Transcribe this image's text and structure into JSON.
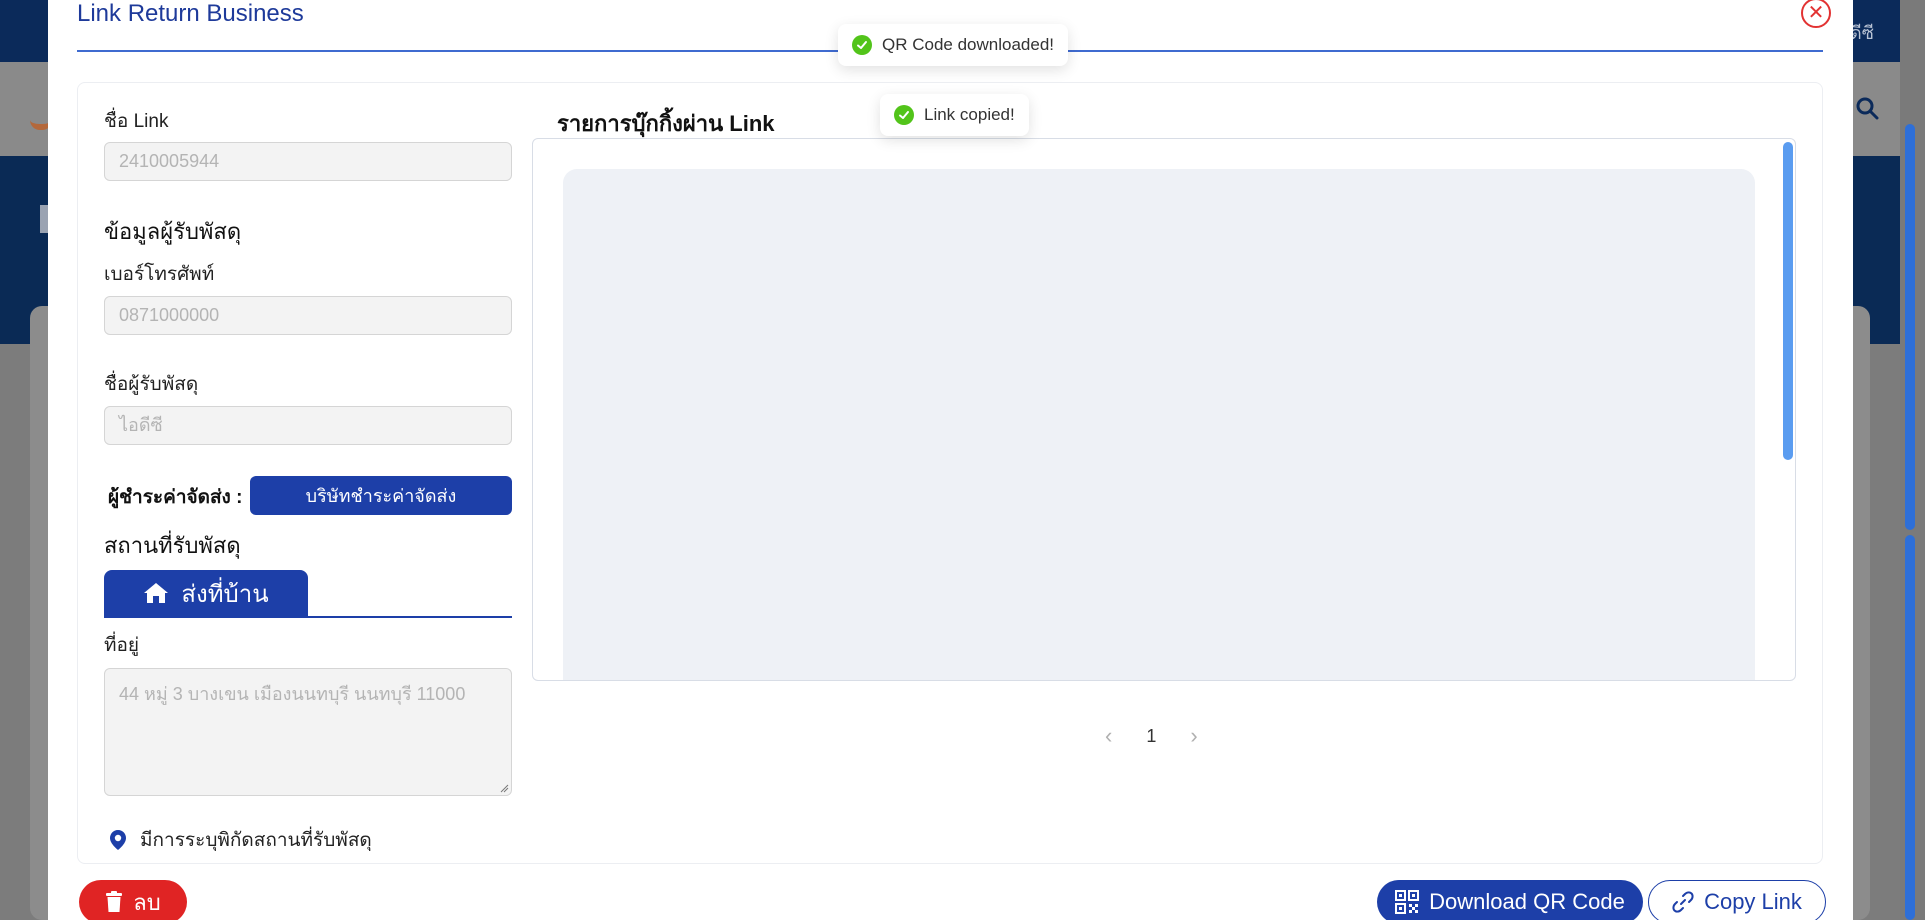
{
  "modal": {
    "title": "Link Return Business",
    "close_icon": "close-circle-icon"
  },
  "form": {
    "link_name_label": "ชื่อ Link",
    "link_name_value": "2410005944",
    "recipient_section": "ข้อมูลผู้รับพัสดุ",
    "phone_label": "เบอร์โทรศัพท์",
    "phone_value": "0871000000",
    "recipient_name_label": "ชื่อผู้รับพัสดุ",
    "recipient_name_value": "ไอดีซี",
    "payer_label": "ผู้ชำระค่าจัดส่ง :",
    "payer_value": "บริษัทชำระค่าจัดส่ง",
    "pickup_section": "สถานที่รับพัสดุ",
    "tab_home_label": "ส่งที่บ้าน",
    "address_label": "ที่อยู่",
    "address_placeholder": "44 หมู่ 3 บางเขน เมืองนนทบุรี นนทบุรี 11000",
    "location_note": "มีการระบุพิกัดสถานที่รับพัสดุ"
  },
  "bookings": {
    "title": "รายการบุ๊กกิ้งผ่าน Link",
    "current_page": "1"
  },
  "footer": {
    "delete_label": "ลบ",
    "download_qr_label": "Download QR Code",
    "copy_link_label": "Copy Link"
  },
  "toasts": {
    "qr": "QR Code downloaded!",
    "link": "Link copied!"
  },
  "background": {
    "user_text": "ดีซี"
  },
  "colors": {
    "primary": "#1d3fa8",
    "danger": "#e02424",
    "success": "#52c41a"
  }
}
